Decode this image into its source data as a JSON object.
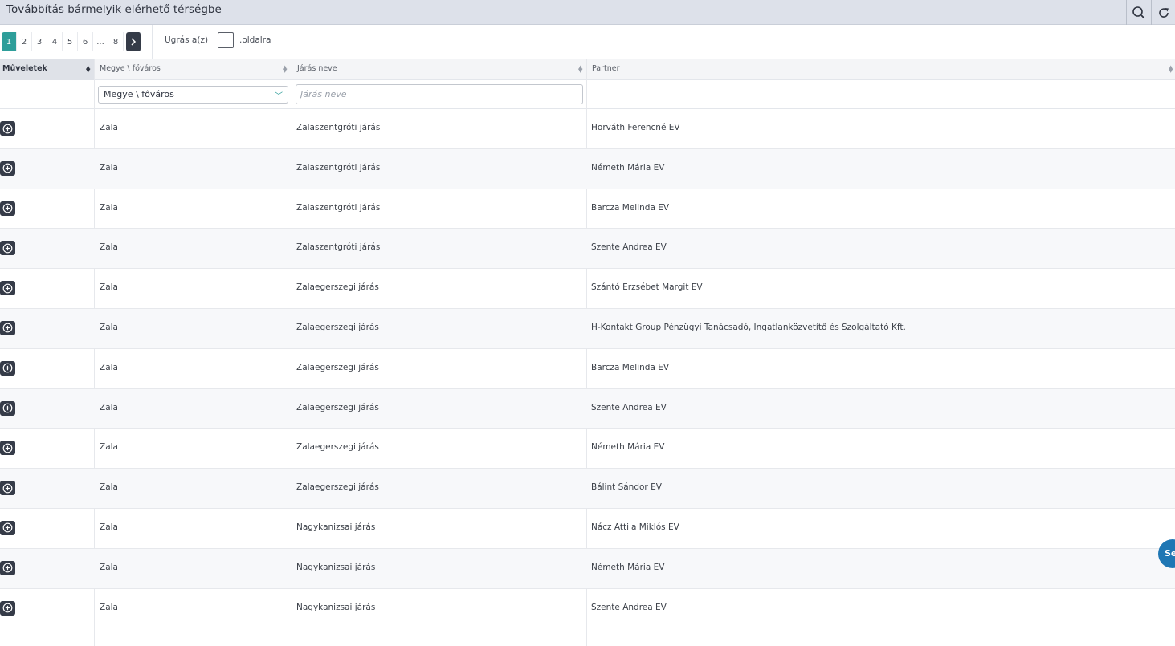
{
  "window": {
    "title": "Továbbítás bármelyik elérhető térségbe"
  },
  "pager": {
    "pages": [
      "1",
      "2",
      "3",
      "4",
      "5",
      "6",
      "...",
      "8"
    ],
    "active_page": "1",
    "jump_label": "Ugrás a(z)",
    "jump_value": "",
    "jump_suffix": ".oldalra"
  },
  "table": {
    "columns": [
      "Műveletek",
      "Megye \\ főváros",
      "Járás neve",
      "Partner"
    ],
    "filters": {
      "county_select": "Megye \\ főváros",
      "district_placeholder": "Járás neve"
    },
    "rows": [
      {
        "county": "Zala",
        "district": "Zalaszentgróti járás",
        "partner": "Horváth Ferencné EV"
      },
      {
        "county": "Zala",
        "district": "Zalaszentgróti járás",
        "partner": "Németh Mária EV"
      },
      {
        "county": "Zala",
        "district": "Zalaszentgróti járás",
        "partner": "Barcza Melinda EV"
      },
      {
        "county": "Zala",
        "district": "Zalaszentgróti járás",
        "partner": "Szente Andrea EV"
      },
      {
        "county": "Zala",
        "district": "Zalaegerszegi járás",
        "partner": "Szántó Erzsébet Margit EV"
      },
      {
        "county": "Zala",
        "district": "Zalaegerszegi járás",
        "partner": "H-Kontakt Group Pénzügyi Tanácsadó, Ingatlanközvetítő és Szolgáltató Kft."
      },
      {
        "county": "Zala",
        "district": "Zalaegerszegi járás",
        "partner": "Barcza Melinda EV"
      },
      {
        "county": "Zala",
        "district": "Zalaegerszegi járás",
        "partner": "Szente Andrea EV"
      },
      {
        "county": "Zala",
        "district": "Zalaegerszegi járás",
        "partner": "Németh Mária EV"
      },
      {
        "county": "Zala",
        "district": "Zalaegerszegi járás",
        "partner": "Bálint Sándor EV"
      },
      {
        "county": "Zala",
        "district": "Nagykanizsai járás",
        "partner": "Nácz Attila Miklós EV"
      },
      {
        "county": "Zala",
        "district": "Nagykanizsai járás",
        "partner": "Németh Mária EV"
      },
      {
        "county": "Zala",
        "district": "Nagykanizsai járás",
        "partner": "Szente Andrea EV"
      }
    ]
  },
  "fab": {
    "label": "Se"
  },
  "colors": {
    "accent": "#2e9e9a",
    "dark_button": "#353b48",
    "topbar": "#dde1ea",
    "fab": "#1f77b4"
  },
  "icons": {
    "search": "search-icon",
    "refresh": "refresh-icon",
    "row_action": "plus-circle-icon",
    "next": "chevron-right-icon"
  }
}
